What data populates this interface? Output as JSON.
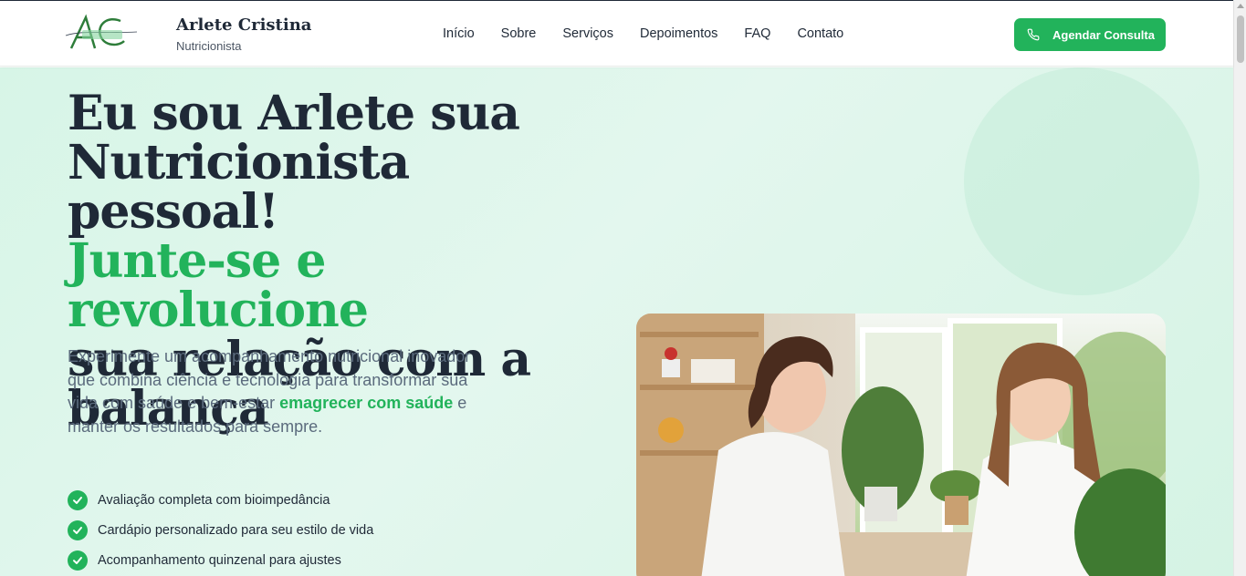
{
  "header": {
    "brand_name": "Arlete Cristina",
    "brand_subtitle": "Nutricionista",
    "nav": [
      "Início",
      "Sobre",
      "Serviços",
      "Depoimentos",
      "FAQ",
      "Contato"
    ],
    "cta_label": "Agendar Consulta",
    "cta_icon": "phone-icon"
  },
  "hero": {
    "headline_line1": "Eu sou Arlete sua",
    "headline_line2": "Nutricionista pessoal!",
    "headline_highlight": "Junte-se e revolucione",
    "headline_line4": "sua relação com a",
    "headline_line5": "balança",
    "intro_part1": "Experimente um acompanhamento nutricional inovador que combina ciência e tecnologia para transformar sua vida com saúde e bem-estar",
    "intro_highlight": "emagrecer com saúde",
    "intro_part2": " e manter os resultados para sempre.",
    "features": [
      "Avaliação completa com bioimpedância",
      "Cardápio personalizado para seu estilo de vida",
      "Acompanhamento quinzenal para ajustes"
    ]
  },
  "colors": {
    "accent": "#22b35b",
    "text_dark": "#1f2937",
    "text_muted": "#5b6b7d",
    "hero_bg": "#d7f5e7"
  }
}
